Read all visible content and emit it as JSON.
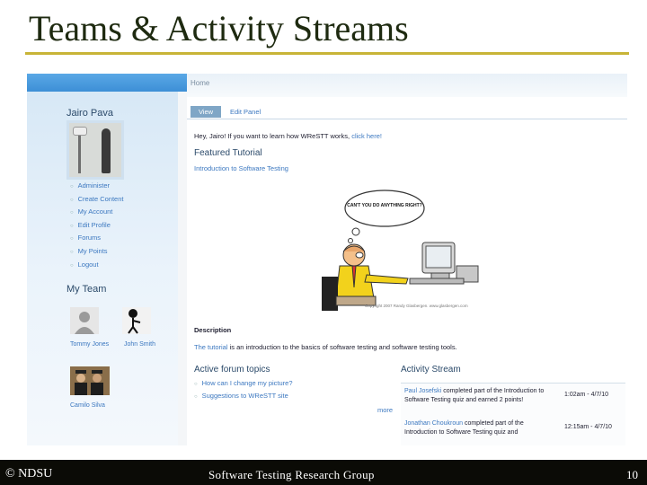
{
  "slide": {
    "title": "Teams & Activity Streams",
    "footer_left": "© NDSU",
    "footer_center": "Software Testing Research Group",
    "page_number": "10"
  },
  "sidebar": {
    "user_name": "Jairo Pava",
    "menu": [
      {
        "label": "Administer"
      },
      {
        "label": "Create Content"
      },
      {
        "label": "My Account"
      },
      {
        "label": "Edit Profile"
      },
      {
        "label": "Forums"
      },
      {
        "label": "My Points"
      },
      {
        "label": "Logout"
      }
    ],
    "team_heading": "My Team",
    "team": [
      {
        "name": "Tommy Jones"
      },
      {
        "name": "John Smith"
      },
      {
        "name": "Camilo Silva"
      }
    ]
  },
  "main": {
    "breadcrumb": "Home",
    "tabs": {
      "view": "View",
      "edit": "Edit Panel"
    },
    "greeting": "Hey, Jairo! If you want to learn how WReSTT works,",
    "greeting_link": "click here!",
    "featured_heading": "Featured Tutorial",
    "featured_link": "Introduction to Software Testing",
    "cartoon_caption": "CAN'T YOU DO ANYTHING RIGHT?",
    "cartoon_copyright": "Copyright 2007 Randy Glasbergen. www.glasbergen.com",
    "description_heading": "Description",
    "description_link": "The tutorial",
    "description_text": "is an introduction to the basics of software testing and software testing tools.",
    "forum_heading": "Active forum topics",
    "forum_topics": [
      {
        "label": "How can I change my picture?"
      },
      {
        "label": "Suggestions to WReSTT site"
      }
    ],
    "more_link": "more",
    "stream_heading": "Activity Stream",
    "stream": [
      {
        "who": "Paul Josefski",
        "text": "completed part of the Introduction to Software Testing quiz and earned 2 points!",
        "time": "1:02am - 4/7/10"
      },
      {
        "who": "Jonathan Choukroun",
        "text": "completed part of the Introduction to Software Testing quiz and",
        "time": "12:15am - 4/7/10"
      }
    ]
  }
}
